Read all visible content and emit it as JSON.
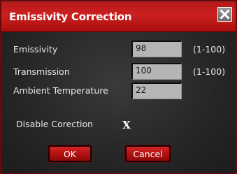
{
  "window": {
    "title": "Emissivity Correction",
    "close_label": "Close"
  },
  "fields": [
    {
      "label": "Emissivity",
      "value": "98",
      "range": "(1-100)"
    },
    {
      "label": "Transmission",
      "value": "100",
      "range": "(1-100)"
    },
    {
      "label": "Ambient Temperature",
      "value": "22",
      "range": ""
    }
  ],
  "disable_correction": {
    "label": "Disable Corection",
    "checked": true,
    "mark": "X"
  },
  "buttons": {
    "ok_label": "OK",
    "cancel_label": "Cancel"
  },
  "colors": {
    "accent": "#c41a1a",
    "background": "#2a2a2a",
    "field_background": "#b5b5b5",
    "text": "#e8e8e8"
  }
}
